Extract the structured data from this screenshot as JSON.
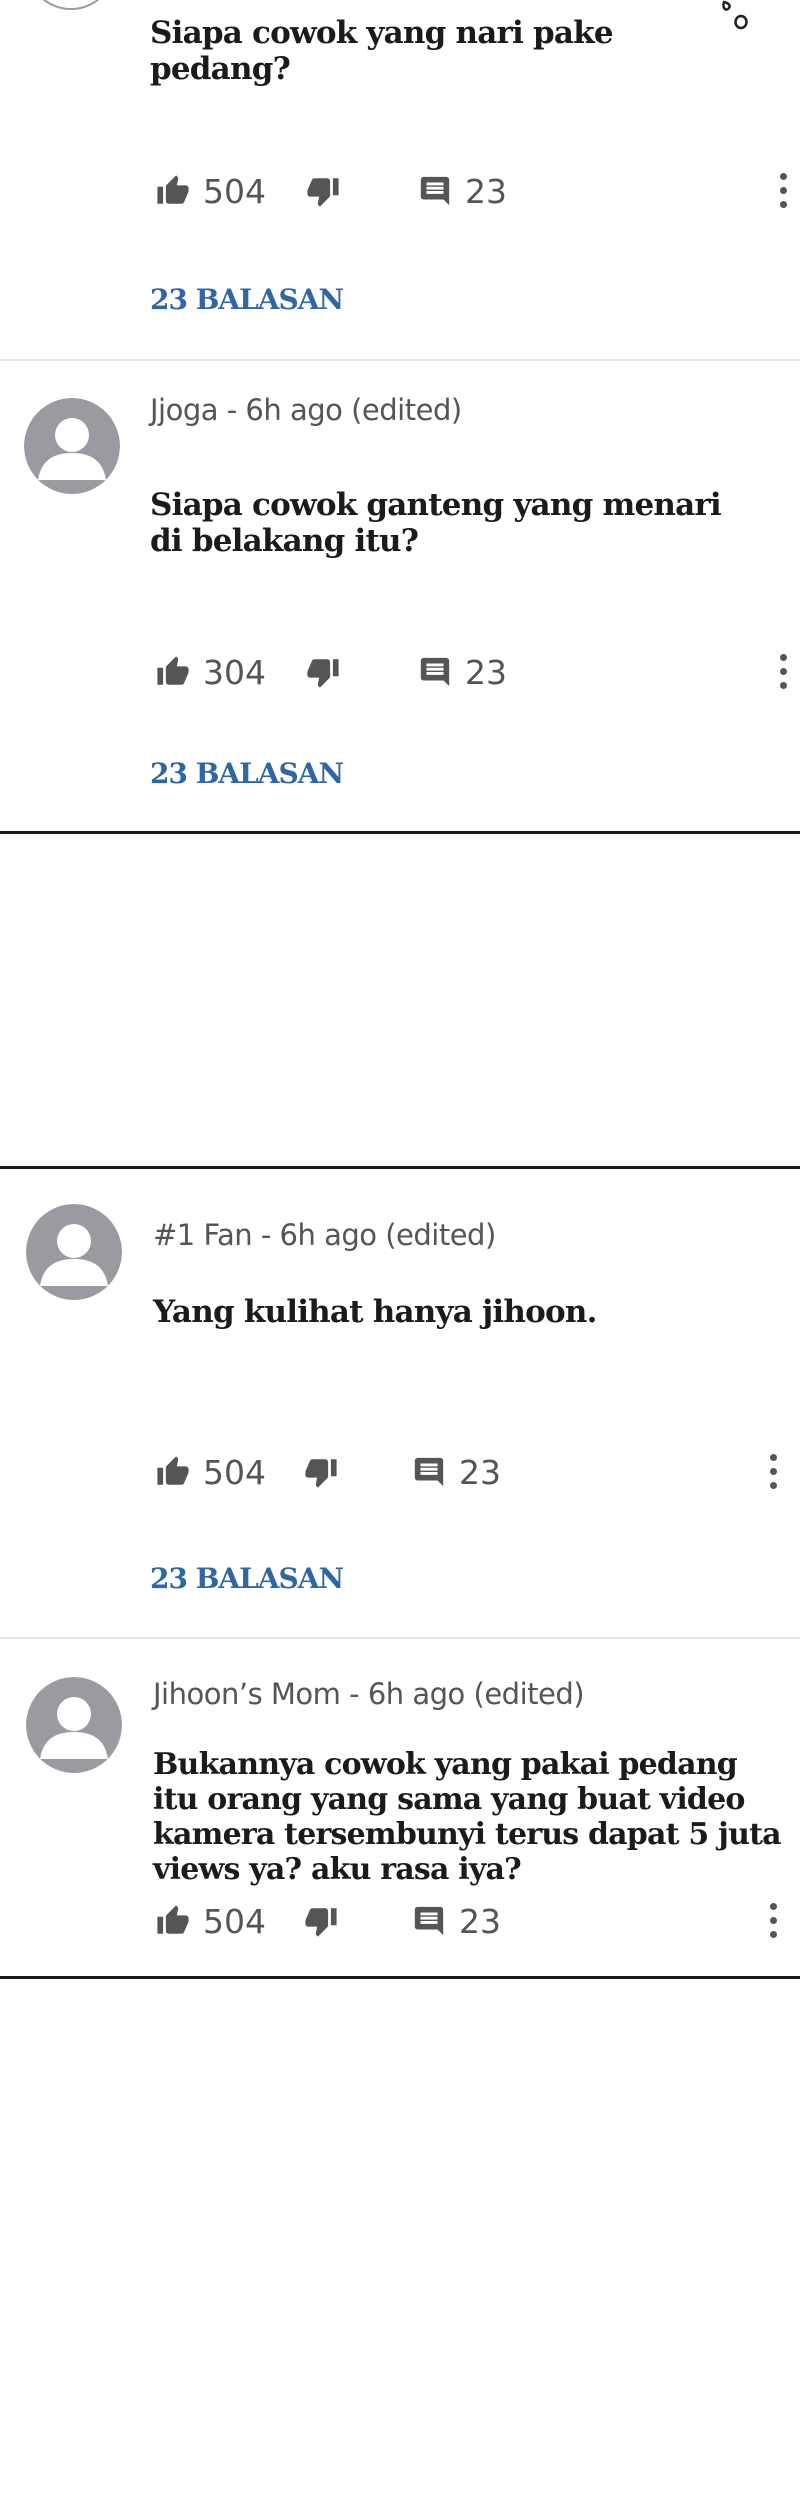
{
  "comments": [
    {
      "author_meta": "",
      "text": "Siapa cowok yang nari pake pedang?",
      "likes": "504",
      "comments": "23",
      "replies_label": "23 BALASAN"
    },
    {
      "author_meta": "Jjoga - 6h ago (edited)",
      "text": "Siapa cowok ganteng yang menari di belakang itu?",
      "likes": "304",
      "comments": "23",
      "replies_label": "23 BALASAN"
    },
    {
      "author_meta": "#1 Fan - 6h ago (edited)",
      "text": "Yang kulihat hanya jihoon.",
      "likes": "504",
      "comments": "23",
      "replies_label": "23 BALASAN"
    },
    {
      "author_meta": "Jihoon’s Mom - 6h ago (edited)",
      "text": "Bukannya cowok yang pakai pedang itu orang yang sama yang buat video kamera tersembunyi terus dapat 5 juta views ya? aku rasa iya?",
      "likes": "504",
      "comments": "23"
    }
  ],
  "icons": {
    "like": "thumbs-up-icon",
    "dislike": "thumbs-down-icon",
    "reply": "comment-icon",
    "more": "more-vertical-icon",
    "avatar": "default-avatar-icon",
    "sweat": "sweat-drops-icon"
  },
  "colors": {
    "accent": "#2f66a8",
    "icon": "#555555",
    "avatar": "#9a9aa0"
  }
}
